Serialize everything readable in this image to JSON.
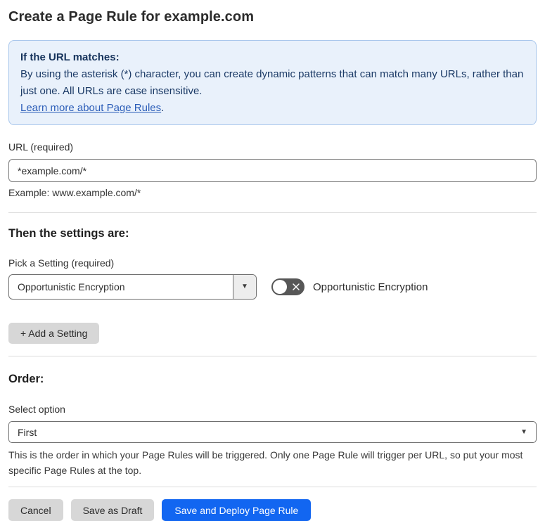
{
  "page": {
    "title": "Create a Page Rule for example.com"
  },
  "info_box": {
    "heading": "If the URL matches:",
    "body": "By using the asterisk (*) character, you can create dynamic patterns that can match many URLs, rather than just one. All URLs are case insensitive.",
    "link": "Learn more about Page Rules",
    "link_suffix": "."
  },
  "url_field": {
    "label": "URL (required)",
    "value": "*example.com/*",
    "example": "Example: www.example.com/*"
  },
  "settings": {
    "heading": "Then the settings are:",
    "picker_label": "Pick a Setting (required)",
    "picker_value": "Opportunistic Encryption",
    "picker_arrow": "▼",
    "toggle_state": "off",
    "toggle_label": "Opportunistic Encryption",
    "add_button_label": "+ Add a Setting"
  },
  "order": {
    "heading": "Order:",
    "select_label": "Select option",
    "select_value": "First",
    "select_arrow": "▼",
    "help": "This is the order in which your Page Rules will be triggered. Only one Page Rule will trigger per URL, so put your most specific Page Rules at the top."
  },
  "footer": {
    "cancel_label": "Cancel",
    "save_draft_label": "Save as Draft",
    "save_deploy_label": "Save and Deploy Page Rule"
  },
  "colors": {
    "info_bg": "#e9f1fb",
    "info_border": "#a9c7ec",
    "info_text": "#1b3a66",
    "link": "#2b5db8",
    "primary_button": "#1266f1",
    "toggle_off": "#575757"
  }
}
